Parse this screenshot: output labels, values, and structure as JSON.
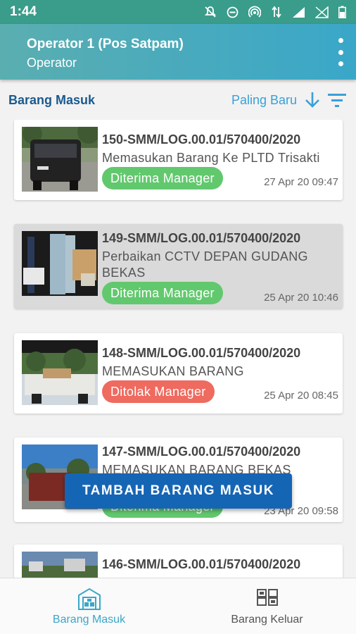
{
  "status_bar": {
    "time": "1:44"
  },
  "app_bar": {
    "title": "Operator 1 (Pos Satpam)",
    "subtitle": "Operator"
  },
  "filter": {
    "section_title": "Barang Masuk",
    "sort_label": "Paling Baru"
  },
  "items": [
    {
      "code": "150-SMM/LOG.00.01/570400/2020",
      "description": "Memasukan Barang Ke PLTD Trisakti",
      "status": "Diterima Manager",
      "date": "27 Apr 20 09:47"
    },
    {
      "code": "149-SMM/LOG.00.01/570400/2020",
      "description": "Perbaikan CCTV DEPAN GUDANG BEKAS",
      "status": "Diterima Manager",
      "date": "25 Apr 20 10:46"
    },
    {
      "code": "148-SMM/LOG.00.01/570400/2020",
      "description": "MEMASUKAN BARANG",
      "status": "Ditolak Manager",
      "date": "25 Apr 20 08:45"
    },
    {
      "code": "147-SMM/LOG.00.01/570400/2020",
      "description": "MEMASUKAN BARANG BEKAS",
      "status": "Diterima Manager",
      "date": "23 Apr 20 09:58"
    },
    {
      "code": "146-SMM/LOG.00.01/570400/2020"
    }
  ],
  "fab": {
    "label": "TAMBAH BARANG MASUK"
  },
  "bottom_nav": {
    "item1": "Barang Masuk",
    "item2": "Barang Keluar"
  },
  "colors": {
    "accent": "#3aa7c9",
    "status_accepted": "#62c86e",
    "status_rejected": "#ef6a5f",
    "fab": "#1565b5"
  }
}
